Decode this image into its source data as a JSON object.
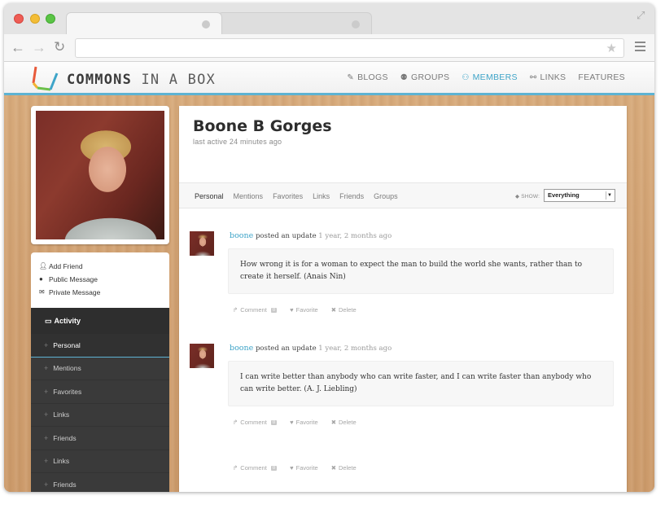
{
  "site": {
    "logo_main": "COMMONS",
    "logo_light": "IN A BOX",
    "nav": [
      {
        "icon": "edit-icon",
        "label": "BLOGS"
      },
      {
        "icon": "group-icon",
        "label": "GROUPS"
      },
      {
        "icon": "members-icon",
        "label": "MEMBERS"
      },
      {
        "icon": "link-icon",
        "label": "LINKS"
      },
      {
        "icon": "",
        "label": "FEATURES"
      }
    ],
    "accent_color": "#3ea4c8"
  },
  "profile": {
    "name": "Boone B Gorges",
    "last_active": "last active 24 minutes ago",
    "actions": [
      {
        "icon": "user-icon",
        "label": "Add Friend"
      },
      {
        "icon": "comment-icon",
        "label": "Public Message"
      },
      {
        "icon": "envelope-icon",
        "label": "Private Message"
      }
    ]
  },
  "sidebar": {
    "heading": "Activity",
    "items": [
      "Personal",
      "Mentions",
      "Favorites",
      "Links",
      "Friends",
      "Links",
      "Friends"
    ]
  },
  "subnav": {
    "tabs": [
      "Personal",
      "Mentions",
      "Favorites",
      "Links",
      "Friends",
      "Groups"
    ],
    "show_label": "SHOW:",
    "show_value": "Everything"
  },
  "activity": [
    {
      "user": "boone",
      "action": "posted an update",
      "time": "1 year, 2 months ago",
      "text": "How wrong it is for a woman to expect the man to build the world she wants, rather than to create it herself. (Anais Nin)",
      "comment_label": "Comment",
      "comment_count": "0",
      "favorite_label": "Favorite",
      "delete_label": "Delete"
    },
    {
      "user": "boone",
      "action": "posted an update",
      "time": "1 year, 2 months ago",
      "text": "I can write better than anybody who can write faster, and I can write faster than anybody who can write better. (A. J. Liebling)",
      "comment_label": "Comment",
      "comment_count": "0",
      "favorite_label": "Favorite",
      "delete_label": "Delete"
    },
    {
      "comment_label": "Comment",
      "comment_count": "0",
      "favorite_label": "Favorite",
      "delete_label": "Delete"
    }
  ]
}
